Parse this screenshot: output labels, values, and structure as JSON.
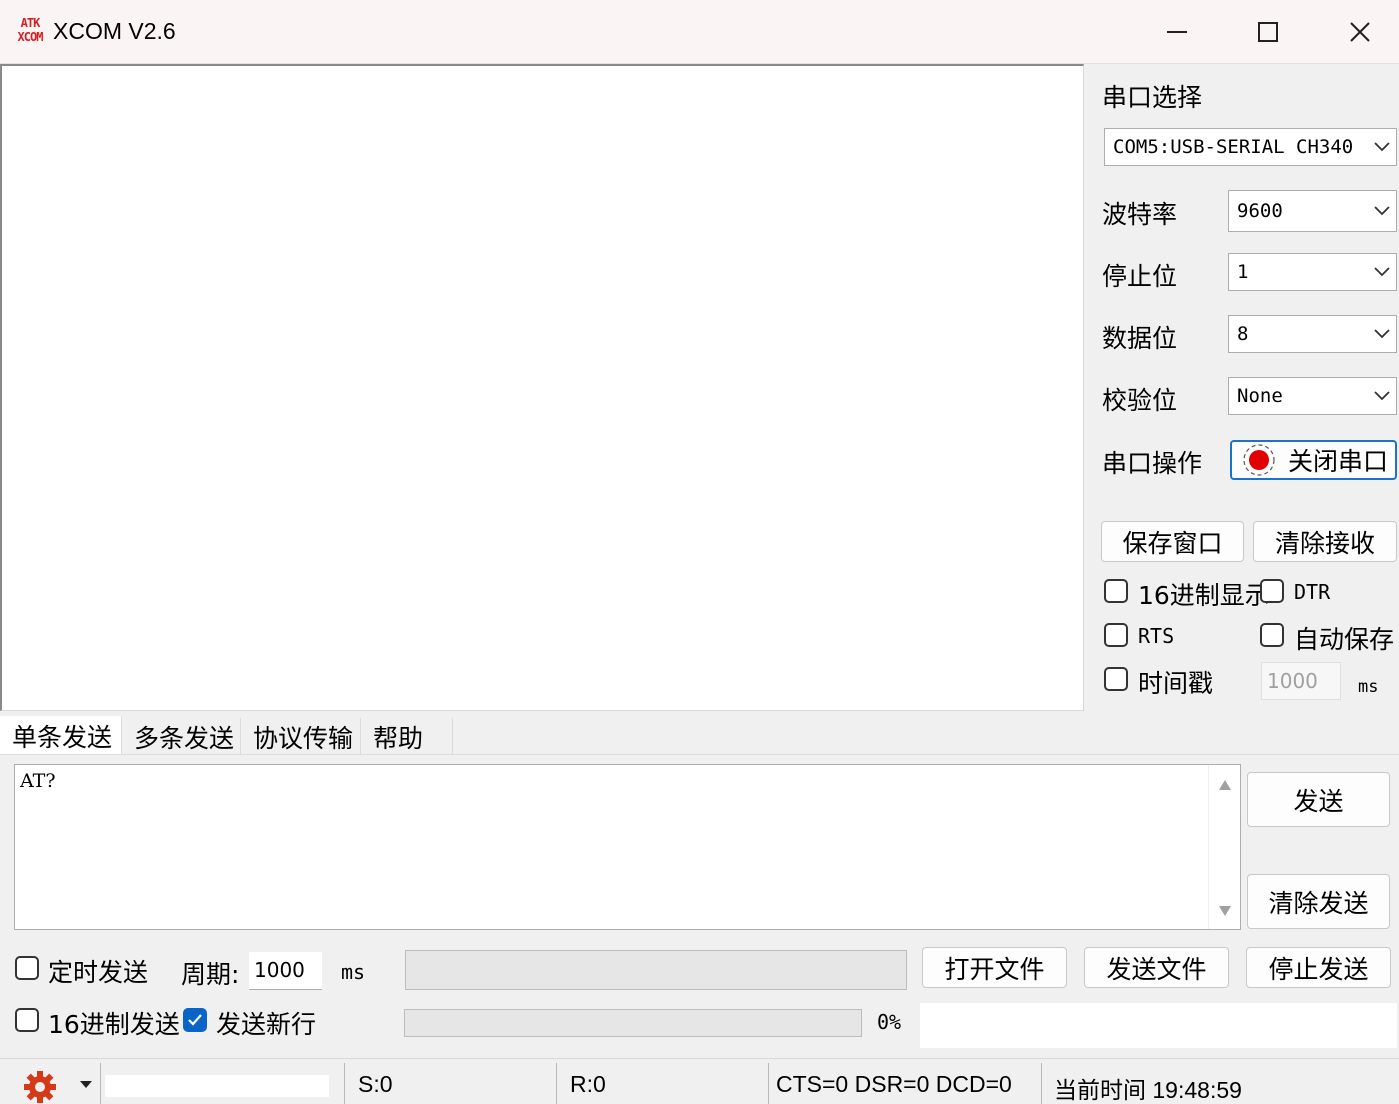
{
  "window": {
    "logo_top": "ATK",
    "logo_bottom": "XCOM",
    "title": "XCOM V2.6"
  },
  "port_panel": {
    "port_select_label": "串口选择",
    "port_value": "COM5:USB-SERIAL CH340",
    "baud_label": "波特率",
    "baud_value": "9600",
    "stop_label": "停止位",
    "stop_value": "1",
    "data_label": "数据位",
    "data_value": "8",
    "parity_label": "校验位",
    "parity_value": "None",
    "operation_label": "串口操作",
    "close_port_button": "关闭串口",
    "port_status_color": "#e00000",
    "save_window_button": "保存窗口",
    "clear_receive_button": "清除接收",
    "hex_display_label": "16进制显示",
    "hex_display_checked": false,
    "dtr_label": "DTR",
    "dtr_checked": false,
    "rts_label": "RTS",
    "rts_checked": false,
    "auto_save_label": "自动保存",
    "auto_save_checked": false,
    "timestamp_label": "时间戳",
    "timestamp_checked": false,
    "timestamp_interval": "1000",
    "timestamp_unit": "ms"
  },
  "tabs": [
    "单条发送",
    "多条发送",
    "协议传输",
    "帮助"
  ],
  "send": {
    "text": "AT?",
    "send_button": "发送",
    "clear_send_button": "清除发送",
    "timed_send_label": "定时发送",
    "timed_send_checked": false,
    "period_label": "周期:",
    "period_value": "1000",
    "period_unit": "ms",
    "open_file_button": "打开文件",
    "send_file_button": "发送文件",
    "stop_send_button": "停止发送",
    "hex_send_label": "16进制发送",
    "hex_send_checked": false,
    "send_newline_label": "发送新行",
    "send_newline_checked": true,
    "progress_percent": "0%",
    "progress_value": 0
  },
  "status": {
    "sent": "S:0",
    "received": "R:0",
    "lines": "CTS=0 DSR=0 DCD=0",
    "time": "当前时间 19:48:59"
  }
}
